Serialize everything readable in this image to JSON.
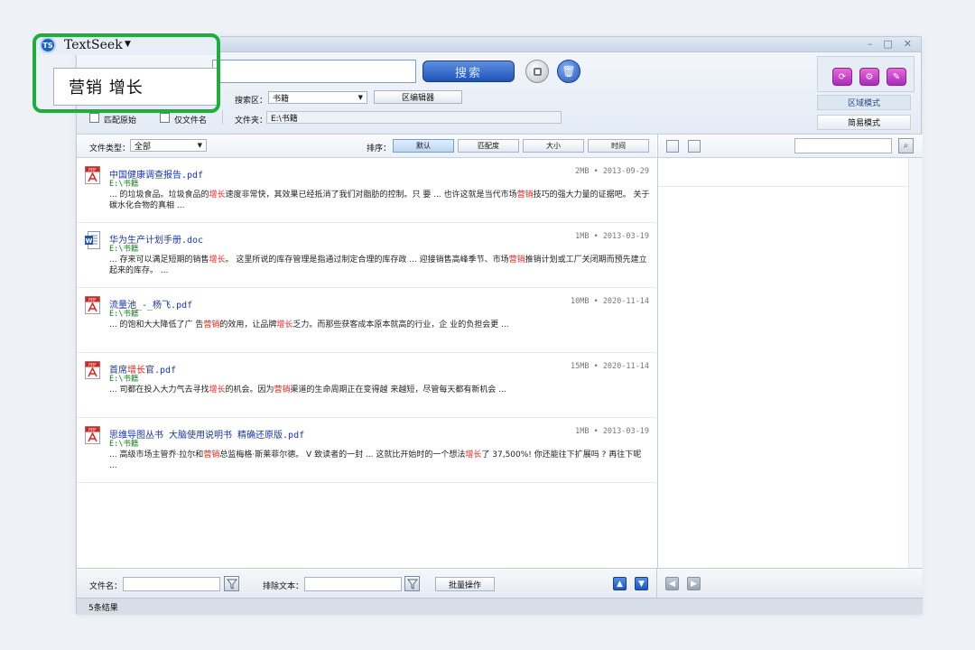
{
  "app": {
    "name": "TextSeek",
    "logo": "TS"
  },
  "window_controls": [
    "–",
    "□",
    "✕"
  ],
  "search": {
    "query": "营销 增长",
    "button": "搜索"
  },
  "options": {
    "area_label": "搜索区：",
    "area_value": "书籍",
    "area_editor": "区编辑器",
    "match_original": "匹配原始",
    "filename_only": "仅文件名",
    "folder_label": "文件夹：",
    "folder_value": "E:\\书籍"
  },
  "modes": {
    "area_mode": "区域模式",
    "simple_mode": "简易模式"
  },
  "filter": {
    "type_label": "文件类型：",
    "type_value": "全部"
  },
  "sort": {
    "label": "排序：",
    "buttons": [
      "默认",
      "匹配度",
      "大小",
      "时间"
    ],
    "active": "默认"
  },
  "results": [
    {
      "icon": "pdf-icon",
      "title": "中国健康调查报告.pdf",
      "path": "E:\\书籍",
      "size": "2MB",
      "date": "2013-09-29",
      "snippet": [
        {
          "t": "... 的垃圾食品。垃圾食品的"
        },
        {
          "t": "增长",
          "h": true
        },
        {
          "t": "速度非常快，其效果已经抵消了我们对脂肪的控制。只 要 ... 也许这就是当代市场"
        },
        {
          "t": "营销",
          "h": true
        },
        {
          "t": "技巧的强大力量的证据吧。 关于碳水化合物的真相 ..."
        }
      ]
    },
    {
      "icon": "doc-icon",
      "title": "华为生产计划手册.doc",
      "path": "E:\\书籍",
      "size": "1MB",
      "date": "2013-03-19",
      "snippet": [
        {
          "t": "... 存来可以满足短期的销售"
        },
        {
          "t": "增长",
          "h": true
        },
        {
          "t": "。 这里所说的库存管理是指通过制定合理的库存政 ... 迎接销售高峰季节、市场"
        },
        {
          "t": "营销",
          "h": true
        },
        {
          "t": "推销计划或工厂关闭期而预先建立起来的库存。      ..."
        }
      ]
    },
    {
      "icon": "pdf-icon",
      "title": "流量池_-_杨飞.pdf",
      "path": "E:\\书籍",
      "size": "10MB",
      "date": "2020-11-14",
      "snippet": [
        {
          "t": "... 的饱和大大降低了广 告"
        },
        {
          "t": "营销",
          "h": true
        },
        {
          "t": "的效用，让品牌"
        },
        {
          "t": "增长",
          "h": true
        },
        {
          "t": "乏力。而那些获客成本原本就高的行业，企 业的负担会更 ..."
        }
      ]
    },
    {
      "icon": "pdf-icon",
      "title_parts": [
        {
          "t": "首席"
        },
        {
          "t": "增长",
          "h": true
        },
        {
          "t": "官.pdf"
        }
      ],
      "path": "E:\\书籍",
      "size": "15MB",
      "date": "2020-11-14",
      "snippet": [
        {
          "t": "... 司都在投入大力气去寻找"
        },
        {
          "t": "增长",
          "h": true
        },
        {
          "t": "的机会。因为"
        },
        {
          "t": "营销",
          "h": true
        },
        {
          "t": "渠道的生命周期正在变得越 来越短，尽管每天都有新机会 ..."
        }
      ]
    },
    {
      "icon": "pdf-icon",
      "title": "思维导图丛书 大脑使用说明书 精确还原版.pdf",
      "path": "E:\\书籍",
      "size": "1MB",
      "date": "2013-03-19",
      "snippet": [
        {
          "t": "... 高级市场主管乔·拉尔和"
        },
        {
          "t": "营销",
          "h": true
        },
        {
          "t": "总监梅格·斯莱菲尔德。 V 致读者的一封 ... 这就比开始时的一个想法"
        },
        {
          "t": "增长",
          "h": true
        },
        {
          "t": "了 37,500%! 你还能往下扩展吗 ? 再往下呢 ..."
        }
      ]
    }
  ],
  "bottom": {
    "filename_label": "文件名：",
    "exclude_label": "排除文本：",
    "batch_button": "批量操作"
  },
  "status": {
    "count_text": "5条结果"
  },
  "colors": {
    "highlight": "#e3261d",
    "title_link": "#1b35a8",
    "path_green": "#137b1f",
    "focus_frame": "#1fae3c",
    "search_button": "#2a5fc4"
  }
}
